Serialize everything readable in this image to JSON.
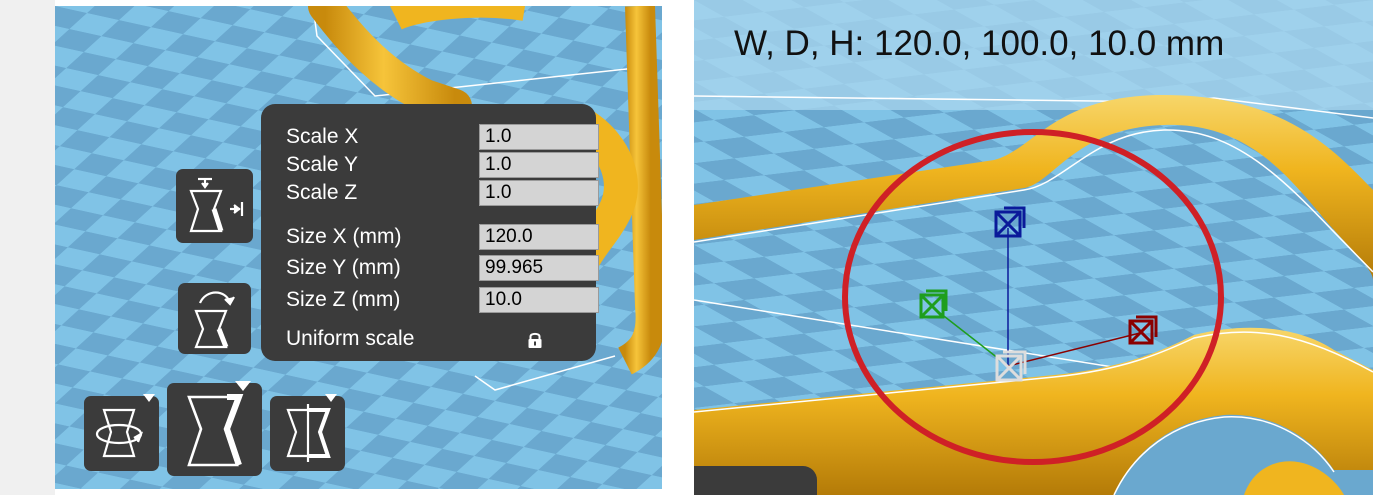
{
  "scale_panel": {
    "rows": [
      {
        "label": "Scale X",
        "value": "1.0"
      },
      {
        "label": "Scale Y",
        "value": "1.0"
      },
      {
        "label": "Scale Z",
        "value": "1.0"
      },
      {
        "label": "Size X (mm)",
        "value": "120.0"
      },
      {
        "label": "Size Y (mm)",
        "value": "99.965"
      },
      {
        "label": "Size Z (mm)",
        "value": "10.0"
      }
    ],
    "uniform_label": "Uniform scale",
    "uniform_icon": "lock-icon"
  },
  "toolbar": {
    "icons": [
      "lay-flat-icon",
      "reset-rotation-icon",
      "rotate-icon",
      "scale-icon",
      "mirror-icon"
    ],
    "active_tool": "scale"
  },
  "viewport": {
    "dimensions_text": "W, D, H: 120.0, 100.0, 10.0 mm",
    "gizmo": {
      "x_handle_color": "#8b0000",
      "y_handle_color": "#1e9e1e",
      "z_handle_color": "#0a1a9a",
      "center_color": "#dddddd"
    },
    "highlight_circle_color": "#cf2026"
  },
  "colors": {
    "plate_blue_light": "#80c3e6",
    "plate_blue_dark": "#6aa8cf",
    "model_yellow": "#f0b51f",
    "panel_bg": "#3b3b3b"
  }
}
